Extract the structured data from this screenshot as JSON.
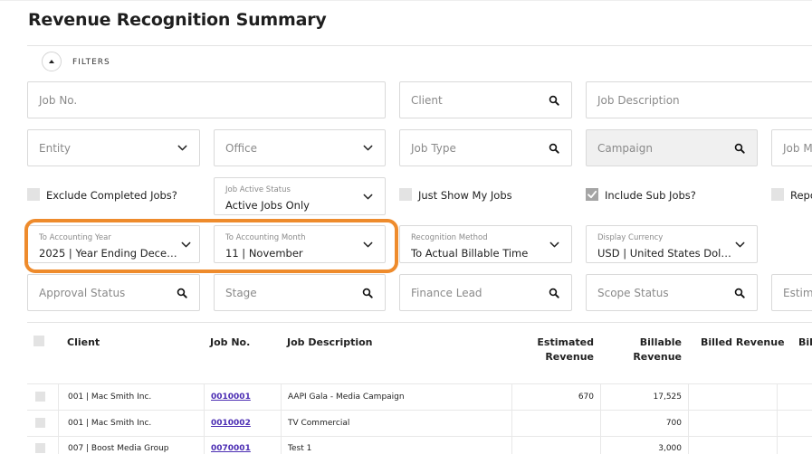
{
  "page": {
    "title": "Revenue Recognition Summary"
  },
  "filters": {
    "label": "FILTERS",
    "job_no": {
      "placeholder": "Job No."
    },
    "client": {
      "placeholder": "Client"
    },
    "job_description": {
      "placeholder": "Job Description"
    },
    "entity": {
      "placeholder": "Entity"
    },
    "office": {
      "placeholder": "Office"
    },
    "job_type": {
      "placeholder": "Job Type"
    },
    "campaign": {
      "placeholder": "Campaign"
    },
    "job_m": {
      "placeholder": "Job M"
    },
    "exclude_completed": {
      "label": "Exclude Completed Jobs?",
      "checked": false
    },
    "job_active_status": {
      "label": "Job Active Status",
      "value": "Active Jobs Only"
    },
    "just_show_my_jobs": {
      "label": "Just Show My Jobs",
      "checked": false
    },
    "include_sub_jobs": {
      "label": "Include Sub Jobs?",
      "checked": true
    },
    "repo": {
      "label": "Repo",
      "checked": false
    },
    "to_accounting_year": {
      "label": "To Accounting Year",
      "value": "2025 | Year Ending December ..."
    },
    "to_accounting_month": {
      "label": "To Accounting Month",
      "value": "11 | November"
    },
    "recognition_method": {
      "label": "Recognition Method",
      "value": "To Actual Billable Time"
    },
    "display_currency": {
      "label": "Display Currency",
      "value": "USD | United States Dollars"
    },
    "approval_status": {
      "placeholder": "Approval Status"
    },
    "stage": {
      "placeholder": "Stage"
    },
    "finance_lead": {
      "placeholder": "Finance Lead"
    },
    "scope_status": {
      "placeholder": "Scope Status"
    },
    "estima": {
      "placeholder": "Estima"
    }
  },
  "table": {
    "headers": {
      "client": "Client",
      "job_no": "Job No.",
      "job_description": "Job Description",
      "estimated_revenue_1": "Estimated",
      "estimated_revenue_2": "Revenue",
      "billable_revenue_1": "Billable",
      "billable_revenue_2": "Revenue",
      "billed_revenue": "Billed Revenue",
      "bil": "Bil"
    },
    "rows": [
      {
        "client": "001 | Mac Smith Inc.",
        "job_no": "0010001",
        "job_description": "AAPI Gala - Media Campaign",
        "estimated_revenue": "670",
        "billable_revenue": "17,525"
      },
      {
        "client": "001 | Mac Smith Inc.",
        "job_no": "0010002",
        "job_description": "TV Commercial",
        "estimated_revenue": "",
        "billable_revenue": "700"
      },
      {
        "client": "007 | Boost Media Group",
        "job_no": "0070001",
        "job_description": "Test 1",
        "estimated_revenue": "",
        "billable_revenue": "3,000"
      }
    ]
  },
  "icons": {
    "search": "search-icon",
    "chevron": "chevron-down-icon",
    "toggle": "chevron-up-icon",
    "check": "checkmark-icon"
  },
  "colors": {
    "highlight": "#ee8b2c",
    "link": "#4b2db3",
    "border": "#d9d9d9"
  }
}
